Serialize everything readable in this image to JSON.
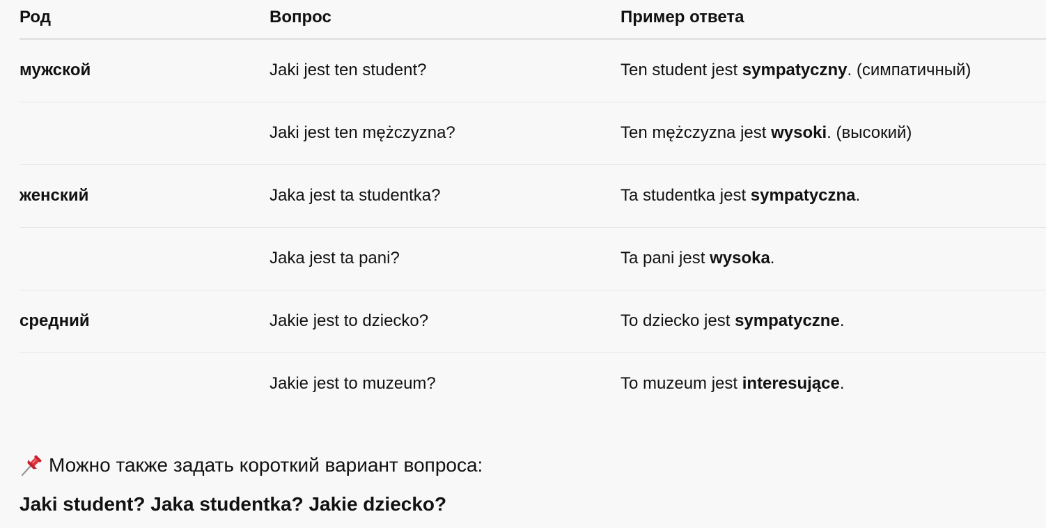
{
  "table": {
    "headers": {
      "gender": "Род",
      "question": "Вопрос",
      "example": "Пример ответа"
    },
    "rows": [
      {
        "gender": "мужской",
        "question": "Jaki jest ten student?",
        "answer": {
          "before": "Ten student jest ",
          "bold": "sympatyczny",
          "after": ". (симпатичный)"
        }
      },
      {
        "gender": "",
        "question": "Jaki jest ten mężczyzna?",
        "answer": {
          "before": "Ten mężczyzna jest ",
          "bold": "wysoki",
          "after": ". (высокий)"
        }
      },
      {
        "gender": "женский",
        "question": "Jaka jest ta studentka?",
        "answer": {
          "before": "Ta studentka jest ",
          "bold": "sympatyczna",
          "after": "."
        }
      },
      {
        "gender": "",
        "question": "Jaka jest ta pani?",
        "answer": {
          "before": "Ta pani jest ",
          "bold": "wysoka",
          "after": "."
        }
      },
      {
        "gender": "средний",
        "question": "Jakie jest to dziecko?",
        "answer": {
          "before": "To dziecko jest ",
          "bold": "sympatyczne",
          "after": "."
        }
      },
      {
        "gender": "",
        "question": "Jakie jest to muzeum?",
        "answer": {
          "before": "To muzeum jest ",
          "bold": "interesujące",
          "after": "."
        }
      }
    ]
  },
  "note": {
    "icon": "pushpin-icon",
    "text": "Можно также задать короткий вариант вопроса:"
  },
  "short_questions": "Jaki student? Jaka studentka? Jakie dziecko?"
}
